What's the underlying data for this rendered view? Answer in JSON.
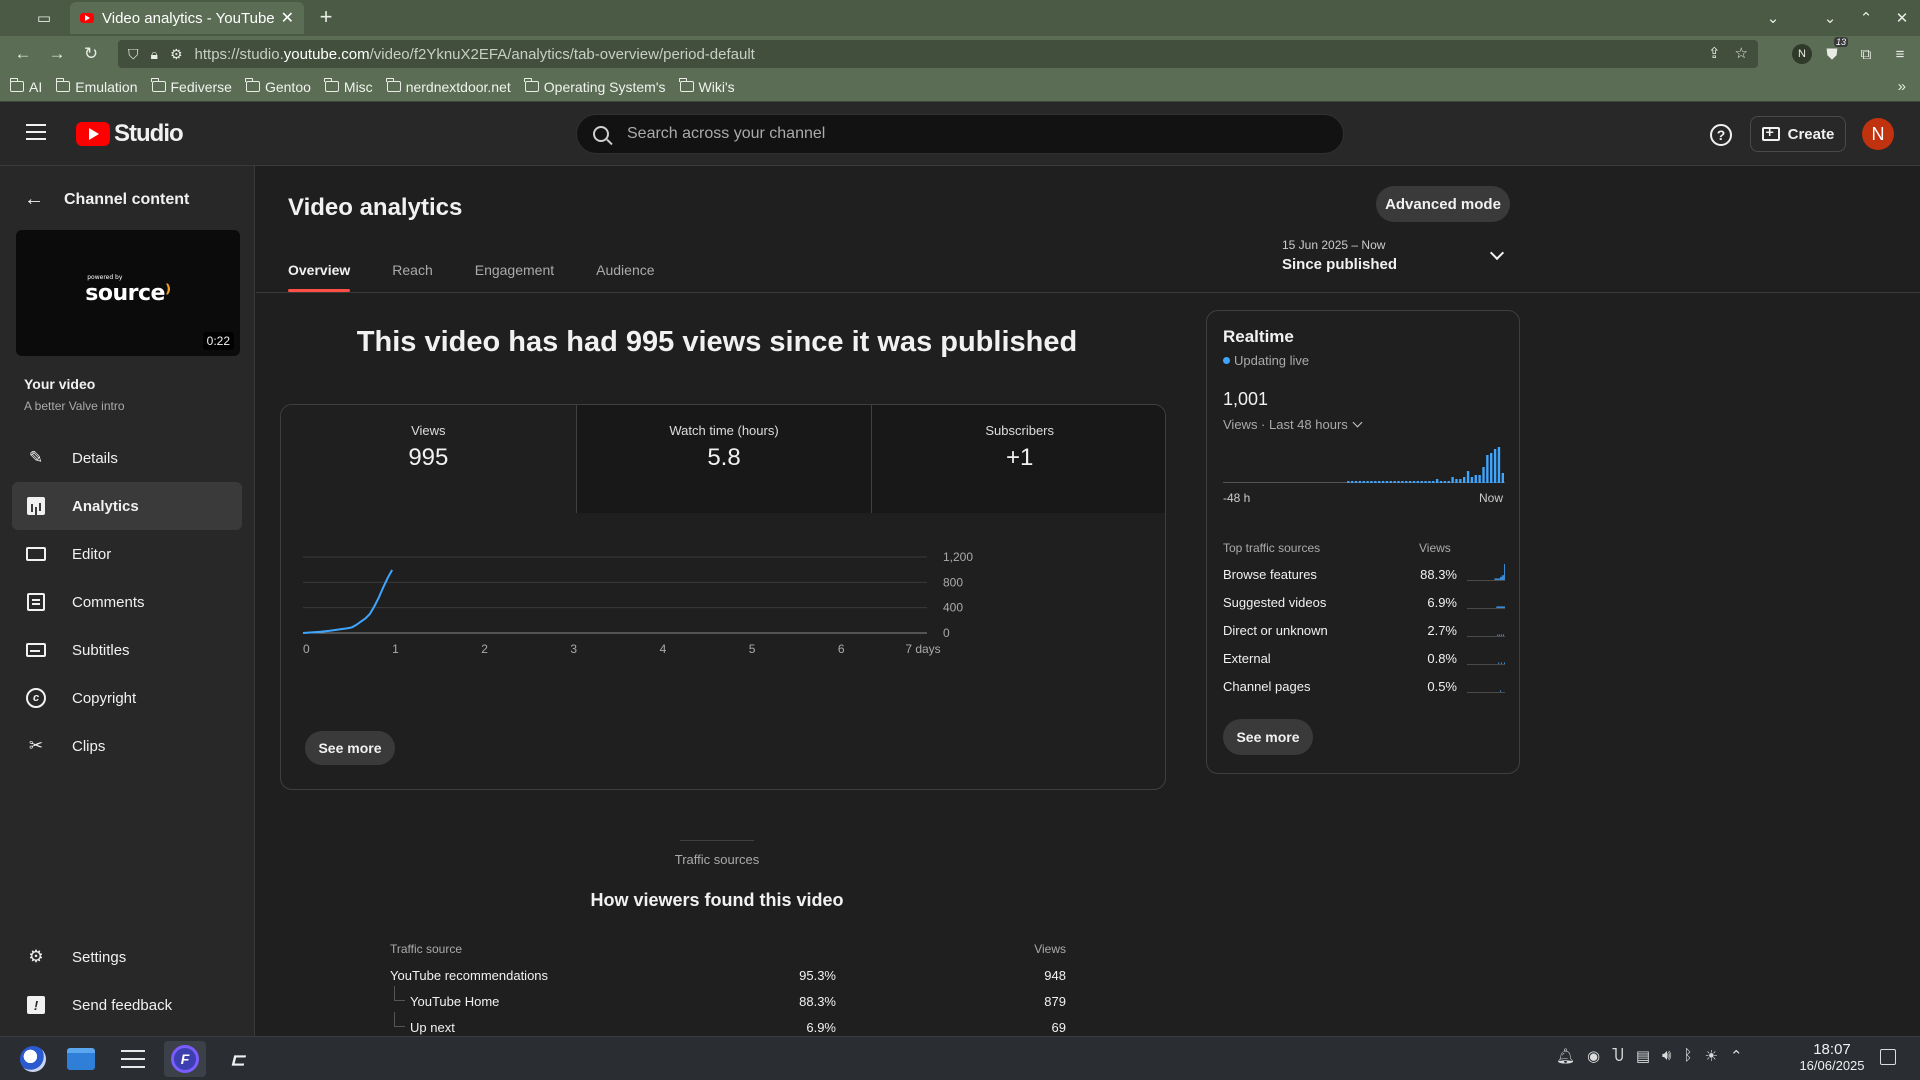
{
  "browser": {
    "tab_title": "Video analytics - YouTube Studio",
    "url_prefix": "https://studio.",
    "url_domain": "youtube.com",
    "url_path": "/video/f2YknuX2EFA/analytics/tab-overview/period-default",
    "extension_badge": "13",
    "profile_initial": "N",
    "bookmarks": [
      "AI",
      "Emulation",
      "Fediverse",
      "Gentoo",
      "Misc",
      "nerdnextdoor.net",
      "Operating System's",
      "Wiki's"
    ]
  },
  "header": {
    "logo_text": "Studio",
    "search_placeholder": "Search across your channel",
    "create_label": "Create",
    "avatar_initial": "N"
  },
  "sidebar": {
    "back_label": "Channel content",
    "thumbnail": {
      "duration": "0:22",
      "logo_caption": "powered by",
      "logo_text": "source"
    },
    "your_video_label": "Your video",
    "video_title": "A better Valve intro",
    "items": [
      {
        "label": "Details",
        "icon": "pencil-icon"
      },
      {
        "label": "Analytics",
        "icon": "analytics-icon",
        "active": true
      },
      {
        "label": "Editor",
        "icon": "editor-icon"
      },
      {
        "label": "Comments",
        "icon": "comments-icon"
      },
      {
        "label": "Subtitles",
        "icon": "subtitles-icon"
      },
      {
        "label": "Copyright",
        "icon": "copyright-icon"
      },
      {
        "label": "Clips",
        "icon": "scissors-icon"
      }
    ],
    "bottom_items": [
      {
        "label": "Settings",
        "icon": "gear-icon"
      },
      {
        "label": "Send feedback",
        "icon": "feedback-icon"
      }
    ]
  },
  "main": {
    "title": "Video analytics",
    "advanced_mode_label": "Advanced mode",
    "tabs": [
      "Overview",
      "Reach",
      "Engagement",
      "Audience"
    ],
    "active_tab": "Overview",
    "period": {
      "range": "15 Jun 2025 – Now",
      "label": "Since published"
    },
    "headline": "This video has had 995 views since it was published",
    "metrics": [
      {
        "label": "Views",
        "value": "995"
      },
      {
        "label": "Watch time (hours)",
        "value": "5.8"
      },
      {
        "label": "Subscribers",
        "value": "+1"
      }
    ],
    "see_more_label": "See more"
  },
  "chart_data": {
    "type": "line",
    "title": "",
    "xlabel": "",
    "ylabel": "",
    "x_ticks": [
      "0",
      "1",
      "2",
      "3",
      "4",
      "5",
      "6",
      "7 days"
    ],
    "y_ticks": [
      "0",
      "400",
      "800",
      "1,200"
    ],
    "ylim": [
      0,
      1200
    ],
    "xlim": [
      0,
      7
    ],
    "grid": true,
    "color": "#3ea6ff",
    "x": [
      0,
      0.1,
      0.2,
      0.3,
      0.4,
      0.5,
      0.55,
      0.6,
      0.65,
      0.7,
      0.75,
      0.8,
      0.85,
      0.9,
      0.95,
      1.0
    ],
    "y": [
      0,
      10,
      20,
      35,
      55,
      75,
      90,
      130,
      180,
      230,
      300,
      420,
      560,
      720,
      870,
      995
    ]
  },
  "realtime": {
    "title": "Realtime",
    "status": "Updating live",
    "count": "1,001",
    "period_label": "Views · Last 48 hours",
    "axis_left": "-48 h",
    "axis_right": "Now",
    "bars": [
      0,
      0,
      0,
      0,
      0,
      0,
      0,
      0,
      0,
      0,
      0,
      0,
      0,
      0,
      0,
      0,
      0,
      0,
      0,
      0,
      0,
      0,
      0,
      0,
      0,
      0,
      0,
      0,
      0,
      0,
      0,
      0,
      1,
      1,
      1,
      1,
      1,
      1,
      1,
      1,
      1,
      1,
      1,
      1,
      1,
      1,
      1,
      1,
      1,
      1,
      1,
      1,
      1,
      1,
      1,
      2,
      1,
      1,
      1,
      3,
      2,
      2,
      3,
      6,
      3,
      4,
      4,
      8,
      14,
      15,
      17,
      18,
      5
    ],
    "table_head_source": "Top traffic sources",
    "table_head_views": "Views",
    "sources": [
      {
        "name": "Browse features",
        "pct": "88.3%",
        "spark": [
          0,
          0,
          0,
          0,
          0,
          0,
          0,
          0,
          0,
          0,
          0,
          0,
          0,
          0,
          0,
          0,
          0,
          0,
          0,
          0,
          0,
          0,
          0,
          0,
          0,
          0,
          0,
          0,
          0,
          1,
          1,
          1,
          1,
          1,
          1,
          2,
          2,
          3,
          3,
          10
        ]
      },
      {
        "name": "Suggested videos",
        "pct": "6.9%",
        "spark": [
          0,
          0,
          0,
          0,
          0,
          0,
          0,
          0,
          0,
          0,
          0,
          0,
          0,
          0,
          0,
          0,
          0,
          0,
          0,
          0,
          0,
          0,
          0,
          0,
          0,
          0,
          0,
          0,
          0,
          0,
          0,
          1,
          1,
          1,
          1,
          1,
          1,
          1,
          1,
          1
        ]
      },
      {
        "name": "Direct or unknown",
        "pct": "2.7%",
        "spark": [
          0,
          0,
          0,
          0,
          0,
          0,
          0,
          0,
          0,
          0,
          0,
          0,
          0,
          0,
          0,
          0,
          0,
          0,
          0,
          0,
          0,
          0,
          0,
          0,
          0,
          0,
          0,
          0,
          0,
          0,
          0,
          0,
          1,
          0,
          1,
          0,
          1,
          0,
          1,
          0
        ]
      },
      {
        "name": "External",
        "pct": "0.8%",
        "spark": [
          0,
          0,
          0,
          0,
          0,
          0,
          0,
          0,
          0,
          0,
          0,
          0,
          0,
          0,
          0,
          0,
          0,
          0,
          0,
          0,
          0,
          0,
          0,
          0,
          0,
          0,
          0,
          0,
          0,
          0,
          0,
          0,
          0,
          1,
          0,
          0,
          1,
          0,
          0,
          1
        ]
      },
      {
        "name": "Channel pages",
        "pct": "0.5%",
        "spark": [
          0,
          0,
          0,
          0,
          0,
          0,
          0,
          0,
          0,
          0,
          0,
          0,
          0,
          0,
          0,
          0,
          0,
          0,
          0,
          0,
          0,
          0,
          0,
          0,
          0,
          0,
          0,
          0,
          0,
          0,
          0,
          0,
          0,
          0,
          0,
          1,
          0,
          0,
          0,
          0
        ]
      }
    ],
    "see_more_label": "See more"
  },
  "traffic": {
    "caption": "Traffic sources",
    "title": "How viewers found this video",
    "head_source": "Traffic source",
    "head_views": "Views",
    "rows": [
      {
        "name": "YouTube recommendations",
        "pct": "95.3%",
        "views": "948",
        "child": false
      },
      {
        "name": "YouTube Home",
        "pct": "88.3%",
        "views": "879",
        "child": true
      },
      {
        "name": "Up next",
        "pct": "6.9%",
        "views": "69",
        "child": true
      }
    ]
  },
  "taskbar": {
    "time": "18:07",
    "date": "16/06/2025"
  }
}
